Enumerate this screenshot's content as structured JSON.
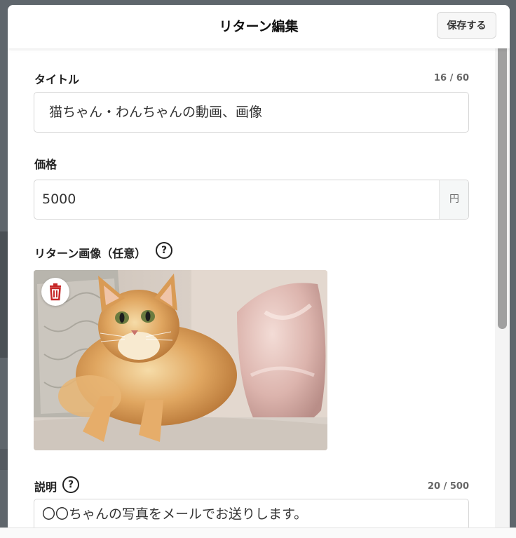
{
  "header": {
    "title": "リターン編集",
    "save_label": "保存する"
  },
  "title_field": {
    "label": "タイトル",
    "counter": "16 / 60",
    "value": "猫ちゃん・わんちゃんの動画、画像"
  },
  "price_field": {
    "label": "価格",
    "value": "5000",
    "unit": "円"
  },
  "image_field": {
    "label": "リターン画像（任意）",
    "help": "?",
    "image_icon": "cat-photo",
    "delete_icon": "trash-icon"
  },
  "description_field": {
    "label": "説明",
    "help": "?",
    "counter": "20 / 500",
    "value": "〇〇ちゃんの写真をメールでお送りします。"
  },
  "colors": {
    "accent_red": "#c62828",
    "border": "#d6d6d6",
    "backdrop": "#5f666c"
  }
}
